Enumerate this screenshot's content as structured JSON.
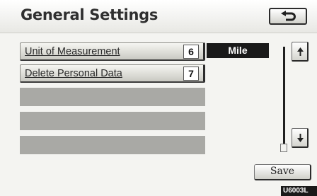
{
  "header": {
    "title": "General Settings",
    "back_icon": "return-arrow-icon"
  },
  "settings": [
    {
      "label": "Unit of Measurement",
      "number": "6",
      "value": "Mile"
    },
    {
      "label": "Delete Personal Data",
      "number": "7"
    }
  ],
  "empty_rows": 3,
  "scroll": {
    "up_icon": "scroll-up-arrow-icon",
    "down_icon": "scroll-down-arrow-icon"
  },
  "footer": {
    "save_label": "Save",
    "doc_code": "U6003L"
  },
  "colors": {
    "background": "#f4f4f1",
    "value_box": "#1a1a1a",
    "empty_row": "#a9a9a5"
  }
}
